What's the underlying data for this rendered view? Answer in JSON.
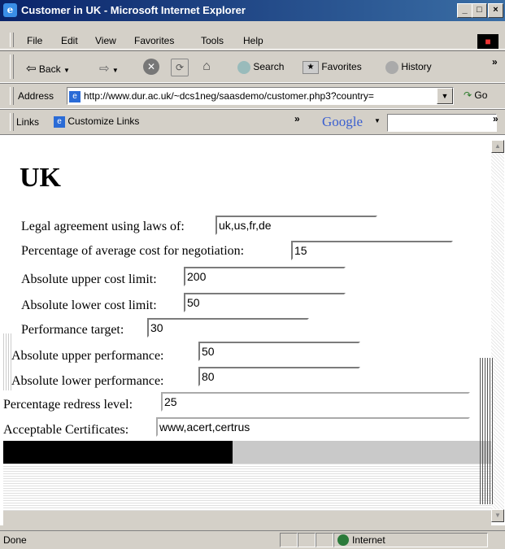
{
  "window": {
    "title": "Customer in UK - Microsoft Internet Explorer",
    "controls": {
      "minimize": "_",
      "maximize": "□",
      "close": "×"
    }
  },
  "menu": {
    "items": [
      {
        "label": "File",
        "accel": "F"
      },
      {
        "label": "Edit",
        "accel": "E"
      },
      {
        "label": "View",
        "accel": "V"
      },
      {
        "label": "Favorites",
        "accel": "a"
      },
      {
        "label": "Tools",
        "accel": "T"
      },
      {
        "label": "Help",
        "accel": "H"
      }
    ]
  },
  "toolbar": {
    "back_label": "Back",
    "search_label": "Search",
    "favorites_label": "Favorites",
    "history_label": "History",
    "overflow": "»"
  },
  "address": {
    "label": "Address",
    "url": "http://www.dur.ac.uk/~dcs1neg/saasdemo/customer.php3?country=",
    "go_label": "Go"
  },
  "links": {
    "label": "Links",
    "customize_label": "Customize Links",
    "overflow": "»",
    "google_label": "Google",
    "google_value": ""
  },
  "page": {
    "heading": "UK",
    "fields": [
      {
        "label": "Legal agreement using laws of:",
        "value": "uk,us,fr,de"
      },
      {
        "label": "Percentage of average cost for negotiation:",
        "value": "15"
      },
      {
        "label": "Absolute upper cost limit:",
        "value": "200"
      },
      {
        "label": "Absolute lower cost limit:",
        "value": "50"
      },
      {
        "label": "Performance target:",
        "value": "30"
      },
      {
        "label": "Absolute upper performance:",
        "value": "50"
      },
      {
        "label": "Absolute lower performance:",
        "value": "80"
      },
      {
        "label": "Percentage redress level:",
        "value": "25"
      },
      {
        "label": "Acceptable Certificates:",
        "value": "www,acert,certrus"
      }
    ]
  },
  "status": {
    "text": "Done",
    "zone": "Internet"
  },
  "colors": {
    "titlebar_start": "#0a246a",
    "titlebar_end": "#3a6ea5",
    "chrome": "#d4d0c8"
  }
}
